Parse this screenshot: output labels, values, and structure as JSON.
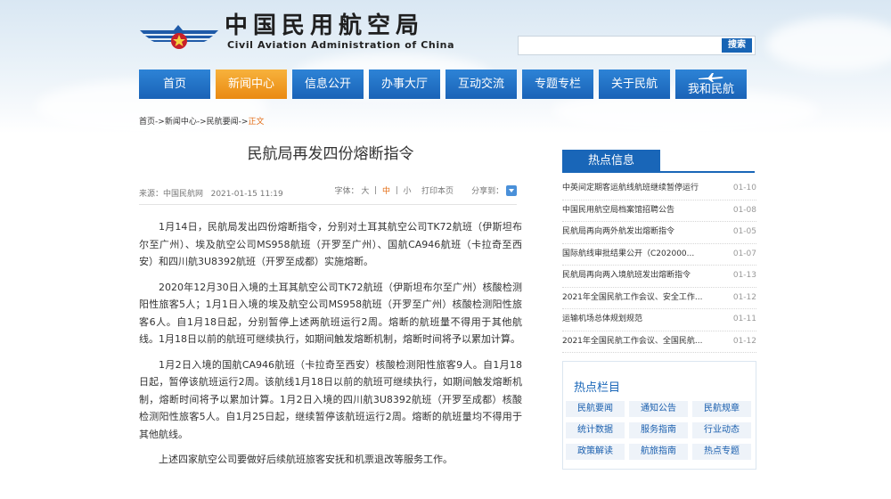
{
  "header": {
    "logo_cn": "中国民用航空局",
    "logo_en": "Civil Aviation Administration of China",
    "search": {
      "placeholder": "",
      "button_label": "搜索"
    }
  },
  "nav": {
    "items": [
      {
        "label": "首页"
      },
      {
        "label": "新闻中心",
        "active": true
      },
      {
        "label": "信息公开"
      },
      {
        "label": "办事大厅"
      },
      {
        "label": "互动交流"
      },
      {
        "label": "专题专栏"
      },
      {
        "label": "关于民航"
      },
      {
        "label": "我和民航"
      }
    ]
  },
  "breadcrumb": {
    "items": [
      "首页",
      "新闻中心",
      "民航要闻"
    ],
    "separator": "->",
    "current": "正文"
  },
  "article": {
    "title": "民航局再发四份熔断指令",
    "source": "来源：中国民航网",
    "date": "2021-01-15 11:19",
    "font_size_label": "字体：",
    "font_large": "大",
    "font_medium": "中",
    "font_small": "小",
    "divider": "|",
    "print_label": "打印本页",
    "share_label": "分享到：",
    "paragraphs": [
      "1月14日，民航局发出四份熔断指令，分别对土耳其航空公司TK72航班（伊斯坦布尔至广州）、埃及航空公司MS958航班（开罗至广州）、国航CA946航班（卡拉奇至西安）和四川航3U8392航班（开罗至成都）实施熔断。",
      "2020年12月30日入境的土耳其航空公司TK72航班（伊斯坦布尔至广州）核酸检测阳性旅客5人；1月1日入境的埃及航空公司MS958航班（开罗至广州）核酸检测阳性旅客6人。自1月18日起，分别暂停上述两航班运行2周。熔断的航班量不得用于其他航线。1月18日以前的航班可继续执行，如期间触发熔断机制，熔断时间将予以累加计算。",
      "1月2日入境的国航CA946航班（卡拉奇至西安）核酸检测阳性旅客9人。自1月18日起，暂停该航班运行2周。该航线1月18日以前的航班可继续执行，如期间触发熔断机制，熔断时间将予以累加计算。1月2日入境的四川航3U8392航班（开罗至成都）核酸检测阳性旅客5人。自1月25日起，继续暂停该航班运行2周。熔断的航班量均不得用于其他航线。",
      "上述四家航空公司要做好后续航班旅客安抚和机票退改等服务工作。"
    ]
  },
  "hot_info": {
    "title": "热点信息",
    "items": [
      {
        "title": "中英间定期客运航线航班继续暂停运行",
        "date": "01-10"
      },
      {
        "title": "中国民用航空局档案馆招聘公告",
        "date": "01-08"
      },
      {
        "title": "民航局再向两外航发出熔断指令",
        "date": "01-05"
      },
      {
        "title": "国际航线审批结果公开（C202000...",
        "date": "01-07"
      },
      {
        "title": "民航局再向两入境航班发出熔断指令",
        "date": "01-13"
      },
      {
        "title": "2021年全国民航工作会议、安全工作...",
        "date": "01-12"
      },
      {
        "title": "运输机场总体规划规范",
        "date": "01-11"
      },
      {
        "title": "2021年全国民航工作会议、全国民航...",
        "date": "01-12"
      }
    ]
  },
  "hot_columns": {
    "title": "热点栏目",
    "items": [
      "民航要闻",
      "通知公告",
      "民航规章",
      "统计数据",
      "服务指南",
      "行业动态",
      "政策解读",
      "航旅指南",
      "热点专题"
    ]
  },
  "colors": {
    "brand_blue": "#1966b8",
    "nav_active": "#ea8a12",
    "accent_orange": "#e36b12"
  }
}
